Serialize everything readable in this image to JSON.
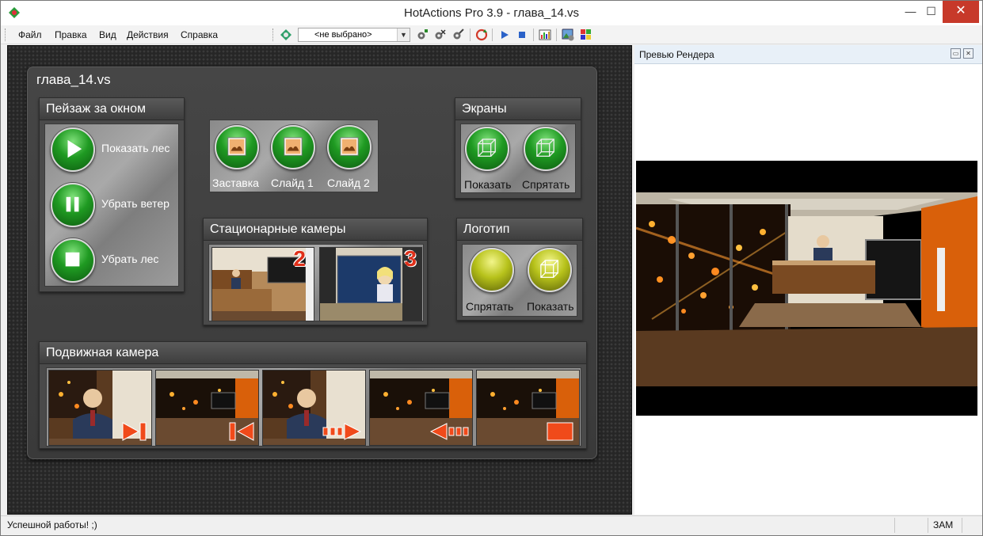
{
  "window": {
    "title": "HotActions Pro 3.9 - глава_14.vs",
    "min_glyph": "—",
    "max_glyph": "☐",
    "close_glyph": "✕"
  },
  "menu": {
    "items": [
      "Файл",
      "Правка",
      "Вид",
      "Действия",
      "Справка"
    ]
  },
  "toolbar": {
    "scene_select": "<не выбрано>",
    "icons": [
      "scene-icon",
      "gear-add-icon",
      "gear-remove-icon",
      "gear-edit-icon",
      "refresh-icon",
      "play-icon",
      "stop-icon",
      "chart-icon",
      "image-settings-icon",
      "palette-icon"
    ]
  },
  "document": {
    "title": "глава_14.vs"
  },
  "landscape": {
    "title": "Пейзаж за окном",
    "buttons": [
      "Показать лес",
      "Убрать ветер",
      "Убрать лес"
    ]
  },
  "slides": {
    "buttons": [
      "Заставка",
      "Слайд 1",
      "Слайд 2"
    ]
  },
  "screens": {
    "title": "Экраны",
    "buttons": [
      "Показать",
      "Спрятать"
    ]
  },
  "static_cameras": {
    "title": "Стационарные камеры",
    "numbers": [
      "2",
      "3"
    ]
  },
  "logo": {
    "title": "Логотип",
    "buttons": [
      "Спрятать",
      "Показать"
    ]
  },
  "moving_camera": {
    "title": "Подвижная камера",
    "thumbs": [
      "camera-shot-1",
      "camera-shot-2",
      "camera-shot-3",
      "camera-shot-4",
      "camera-shot-5"
    ]
  },
  "preview": {
    "title": "Превью Рендера"
  },
  "status": {
    "message": "Успешной работы! ;)",
    "caps": "ЗАМ"
  },
  "colors": {
    "accent_green": "#1f9a22",
    "accent_yellow": "#b7c21b",
    "close_red": "#c7392a",
    "studio_orange": "#d9600a"
  }
}
